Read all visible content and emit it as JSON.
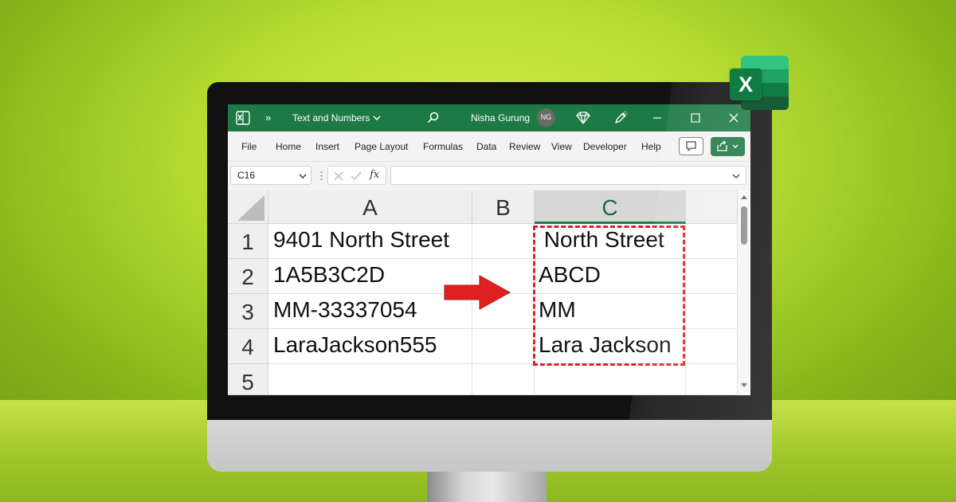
{
  "window": {
    "title": "Text and Numbers",
    "user_name": "Nisha Gurung",
    "user_initials": "NG",
    "chevron": "»"
  },
  "logo": {
    "letter": "X"
  },
  "ribbon": {
    "tabs": [
      "File",
      "Home",
      "Insert",
      "Page Layout",
      "Formulas",
      "Data",
      "Review",
      "View",
      "Developer",
      "Help"
    ]
  },
  "formula_bar": {
    "name_box": "C16",
    "fx_label": "fx",
    "formula": ""
  },
  "sheet": {
    "columns": [
      "A",
      "B",
      "C"
    ],
    "selected_column": "C",
    "rows": [
      {
        "num": "1",
        "A": "9401 North Street",
        "B": "",
        "C": " North Street"
      },
      {
        "num": "2",
        "A": "1A5B3C2D",
        "B": "",
        "C": "ABCD"
      },
      {
        "num": "3",
        "A": "MM-33337054",
        "B": "",
        "C": "MM"
      },
      {
        "num": "4",
        "A": "LaraJackson555",
        "B": "",
        "C": "Lara Jackson"
      },
      {
        "num": "5",
        "A": "",
        "B": "",
        "C": ""
      }
    ]
  },
  "colors": {
    "excel_green": "#1e7a45",
    "annotation_red": "#e02222",
    "background_lime": "#c4e83d"
  },
  "icons": [
    "excel-app-icon",
    "search-icon",
    "diamond-icon",
    "pen-icon",
    "minimize-icon",
    "maximize-icon",
    "close-icon",
    "comment-icon",
    "share-icon",
    "right-arrow"
  ]
}
